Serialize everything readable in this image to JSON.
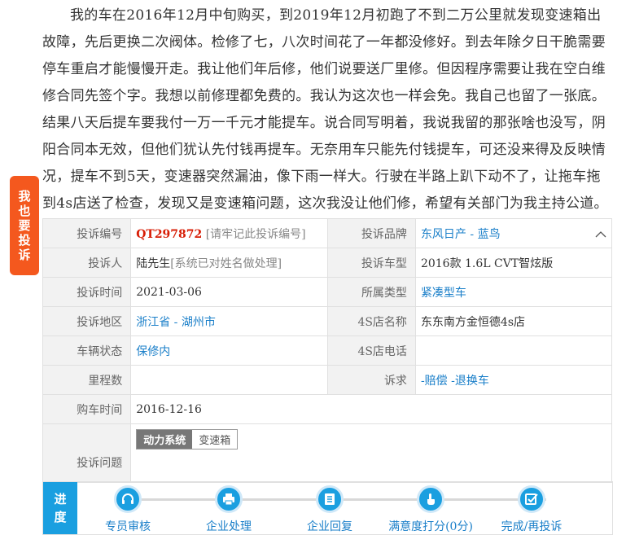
{
  "story": "我的车在2016年12月中旬购买，到2019年12月初跑了不到二万公里就发现变速箱出故障，先后更换二次阀体。检修了七，八次时间花了一年都没修好。到去年除夕日干脆需要停车重启才能慢慢开走。我让他们年后修，他们说要送厂里修。但因程序需要让我在空白维修合同先签个字。我想以前修理都免费的。我认为这次也一样会免。我自己也留了一张底。结果八天后提车要我付一万一千元才能提车。说合同写明着，我说我留的那张啥也没写，阴阳合同本无效，但他们犹认先付钱再提车。无奈用车只能先付钱提车，可还没来得及反映情况，提车不到5天，变速器突然漏油，像下雨一样大。行驶在半路上趴下动不了，让拖车拖到4s店送了检查，发现又是变速箱问题，这次我没让他们修，希望有关部门为我主持公道。",
  "side_button": [
    "我",
    "也",
    "要",
    "投",
    "诉"
  ],
  "info": {
    "complaint_no_label": "投诉编号",
    "complaint_no": "QT297872",
    "complaint_no_note": "[请牢记此投诉编号]",
    "brand_label": "投诉品牌",
    "brand": "东风日产 - 蓝鸟",
    "complainant_label": "投诉人",
    "complainant": "陆先生",
    "complainant_note": "[系统已对姓名做处理]",
    "model_label": "投诉车型",
    "model": "2016款 1.6L CVT智炫版",
    "time_label": "投诉时间",
    "time": "2021-03-06",
    "type_label": "所属类型",
    "type": "紧凑型车",
    "region_label": "投诉地区",
    "region": "浙江省 - 湖州市",
    "dealer_label": "4S店名称",
    "dealer": "东东南方金恒德4s店",
    "status_label": "车辆状态",
    "status": "保修内",
    "dealer_phone_label": "4S店电话",
    "dealer_phone": "",
    "mileage_label": "里程数",
    "mileage": "",
    "demand_label": "诉求",
    "demand": "-赔偿 -退换车",
    "purchase_label": "购车时间",
    "purchase": "2016-12-16",
    "issue_label": "投诉问题",
    "issue_tag1": "动力系统",
    "issue_tag2": "变速箱"
  },
  "progress": {
    "label": [
      "进",
      "度"
    ],
    "steps": [
      "专员审核",
      "企业处理",
      "企业回复",
      "满意度打分(0分)",
      "完成/再投诉"
    ]
  },
  "colors": {
    "accent": "#1a9fe0",
    "side_button": "#f4581e",
    "code_red": "#d81e06"
  }
}
